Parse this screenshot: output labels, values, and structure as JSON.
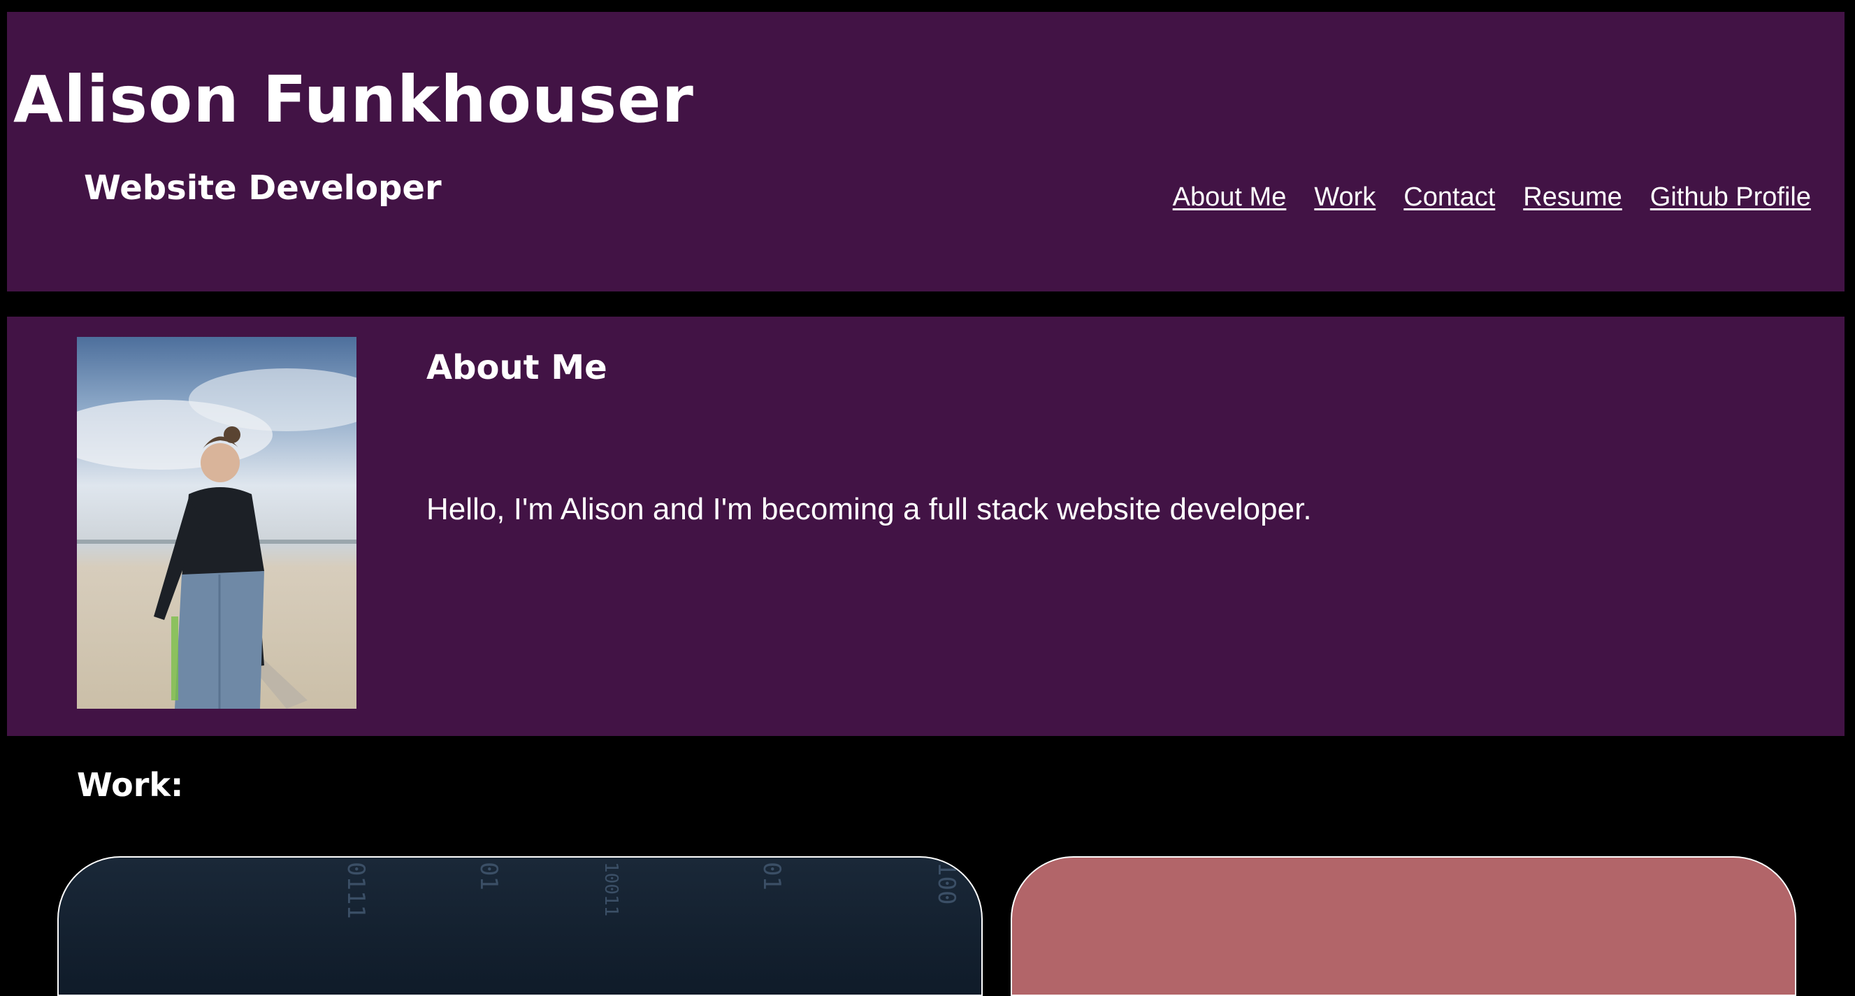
{
  "header": {
    "title": "Alison Funkhouser",
    "subtitle": "Website Developer",
    "nav": [
      {
        "label": "About Me"
      },
      {
        "label": "Work"
      },
      {
        "label": "Contact"
      },
      {
        "label": "Resume"
      },
      {
        "label": "Github Profile"
      }
    ]
  },
  "about": {
    "heading": "About Me",
    "text": "Hello, I'm Alison and I'm becoming a full stack website developer."
  },
  "work": {
    "heading": "Work:"
  },
  "colors": {
    "panel": "#421345",
    "background": "#000000",
    "card_2": "#b26569"
  }
}
